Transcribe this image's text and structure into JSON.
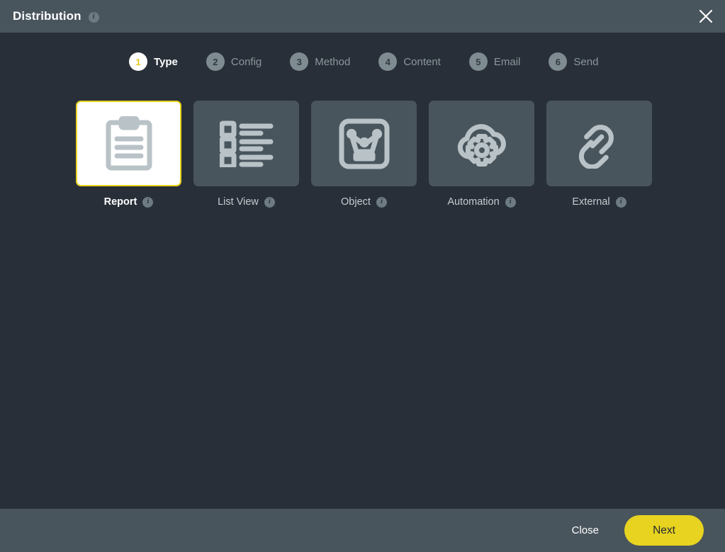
{
  "header": {
    "title": "Distribution",
    "info_icon": "info-icon",
    "info_glyph": "i",
    "close_icon": "close-icon"
  },
  "stepper": {
    "steps": [
      {
        "number": "1",
        "label": "Type",
        "active": true
      },
      {
        "number": "2",
        "label": "Config",
        "active": false
      },
      {
        "number": "3",
        "label": "Method",
        "active": false
      },
      {
        "number": "4",
        "label": "Content",
        "active": false
      },
      {
        "number": "5",
        "label": "Email",
        "active": false
      },
      {
        "number": "6",
        "label": "Send",
        "active": false
      }
    ]
  },
  "types": [
    {
      "label": "Report",
      "icon": "clipboard-icon",
      "selected": true,
      "info_glyph": "i"
    },
    {
      "label": "List View",
      "icon": "checklist-icon",
      "selected": false,
      "info_glyph": "i"
    },
    {
      "label": "Object",
      "icon": "crown-icon",
      "selected": false,
      "info_glyph": "i"
    },
    {
      "label": "Automation",
      "icon": "cloud-gear-icon",
      "selected": false,
      "info_glyph": "i"
    },
    {
      "label": "External",
      "icon": "link-icon",
      "selected": false,
      "info_glyph": "i"
    }
  ],
  "footer": {
    "close_label": "Close",
    "next_label": "Next"
  },
  "colors": {
    "accent_yellow": "#e8d320",
    "header_bar": "#49555d",
    "body_background": "#282f38",
    "card_background": "#49555d",
    "icon_stroke": "#b9c3c7",
    "step_inactive": "#7e8b90"
  }
}
